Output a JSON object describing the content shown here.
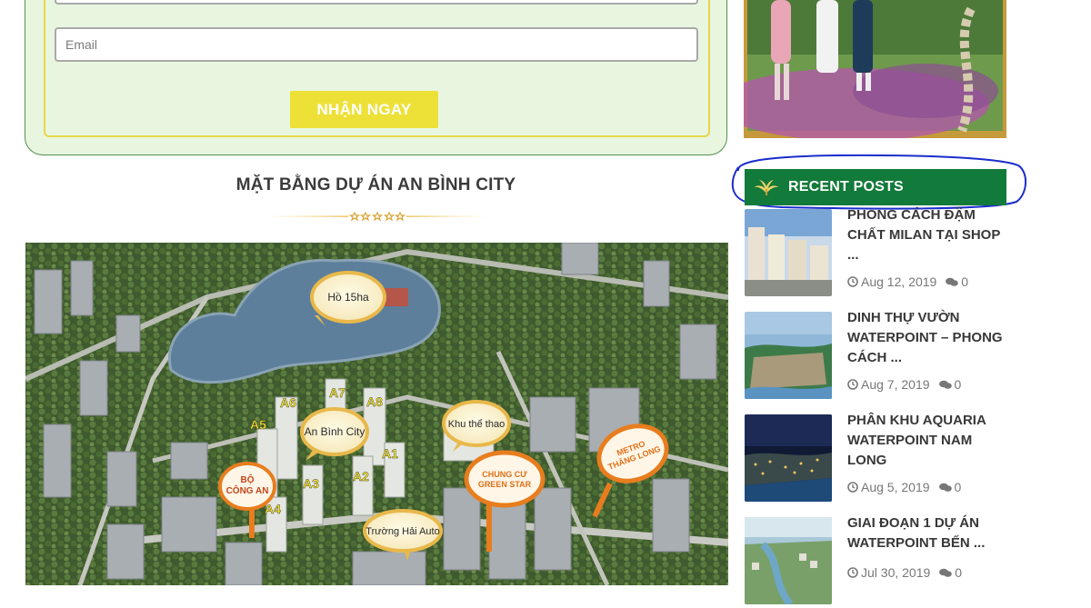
{
  "form": {
    "email_placeholder": "Email",
    "submit_label": "NHẬN NGAY"
  },
  "section": {
    "title": "MẶT BẰNG DỰ ÁN AN BÌNH CITY"
  },
  "map": {
    "labels": {
      "lake": "Hồ 15ha",
      "an_binh_city": "An Bình City",
      "sports": "Khu thể thao",
      "police_line1": "BỘ",
      "police_line2": "CÔNG AN",
      "green_star_line1": "CHUNG CƯ",
      "green_star_line2": "GREEN STAR",
      "metro_line1": "METRO",
      "metro_line2": "THĂNG LONG",
      "school": "Trường Hải Auto"
    },
    "buildings": [
      "A1",
      "A2",
      "A3",
      "A4",
      "A5",
      "A6",
      "A7",
      "A8"
    ]
  },
  "sidebar": {
    "recent_posts_title": "RECENT POSTS",
    "posts": [
      {
        "title": "PHONG CÁCH ĐẬM CHẤT MILAN TẠI SHOP ...",
        "date": "Aug 12, 2019",
        "comments": "0"
      },
      {
        "title": "DINH THỰ VƯỜN WATERPOINT – PHONG CÁCH ...",
        "date": "Aug 7, 2019",
        "comments": "0"
      },
      {
        "title": "PHÂN KHU AQUARIA WATERPOINT NAM LONG",
        "date": "Aug 5, 2019",
        "comments": "0"
      },
      {
        "title": "GIAI ĐOẠN 1 DỰ ÁN WATERPOINT BẾN ...",
        "date": "Jul 30, 2019",
        "comments": "0"
      }
    ]
  },
  "colors": {
    "form_bg": "#e9f6df",
    "button": "#ede138",
    "header_green": "#127a3a",
    "annotation_blue": "#1a2ccc"
  }
}
